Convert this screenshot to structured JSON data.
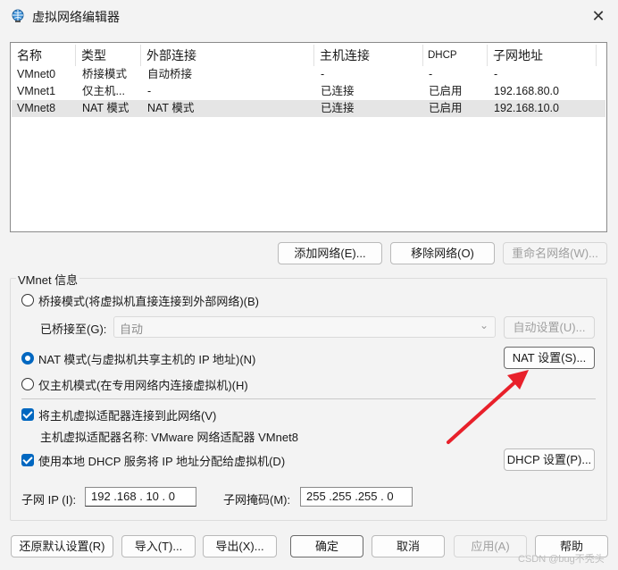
{
  "window": {
    "title": "虚拟网络编辑器",
    "close_glyph": "✕"
  },
  "table": {
    "headers": [
      "名称",
      "类型",
      "外部连接",
      "主机连接",
      "DHCP",
      "子网地址"
    ],
    "rows": [
      [
        "VMnet0",
        "桥接模式",
        "自动桥接",
        "-",
        "-",
        "-"
      ],
      [
        "VMnet1",
        "仅主机...",
        "-",
        "已连接",
        "已启用",
        "192.168.80.0"
      ],
      [
        "VMnet8",
        "NAT 模式",
        "NAT 模式",
        "已连接",
        "已启用",
        "192.168.10.0"
      ]
    ],
    "selected_row": 2
  },
  "table_buttons": {
    "add": "添加网络(E)...",
    "remove": "移除网络(O)",
    "rename": "重命名网络(W)..."
  },
  "vmnet_info": {
    "group_title": "VMnet 信息",
    "bridge_mode_label": "桥接模式(将虚拟机直接连接到外部网络)(B)",
    "bridged_to_label": "已桥接至(G):",
    "bridged_to_value": "自动",
    "auto_settings": "自动设置(U)...",
    "nat_mode_label": "NAT 模式(与虚拟机共享主机的 IP 地址)(N)",
    "nat_settings": "NAT 设置(S)...",
    "host_only_label": "仅主机模式(在专用网络内连接虚拟机)(H)",
    "connect_adapter_label": "将主机虚拟适配器连接到此网络(V)",
    "adapter_name_label": "主机虚拟适配器名称: VMware 网络适配器 VMnet8",
    "use_dhcp_label": "使用本地 DHCP 服务将 IP 地址分配给虚拟机(D)",
    "dhcp_settings": "DHCP 设置(P)...",
    "subnet_ip_label": "子网 IP (I):",
    "subnet_ip_value": "192 .168 . 10  .  0",
    "subnet_mask_label": "子网掩码(M):",
    "subnet_mask_value": "255 .255 .255 .  0",
    "selected_mode": "nat",
    "connect_adapter_checked": true,
    "use_dhcp_checked": true
  },
  "footer": {
    "restore": "还原默认设置(R)",
    "import": "导入(T)...",
    "export": "导出(X)...",
    "ok": "确定",
    "cancel": "取消",
    "apply": "应用(A)",
    "help": "帮助"
  },
  "watermark": "CSDN @bug不秃头",
  "colors": {
    "accent": "#0067c0",
    "annotation_arrow": "#e8202a"
  }
}
